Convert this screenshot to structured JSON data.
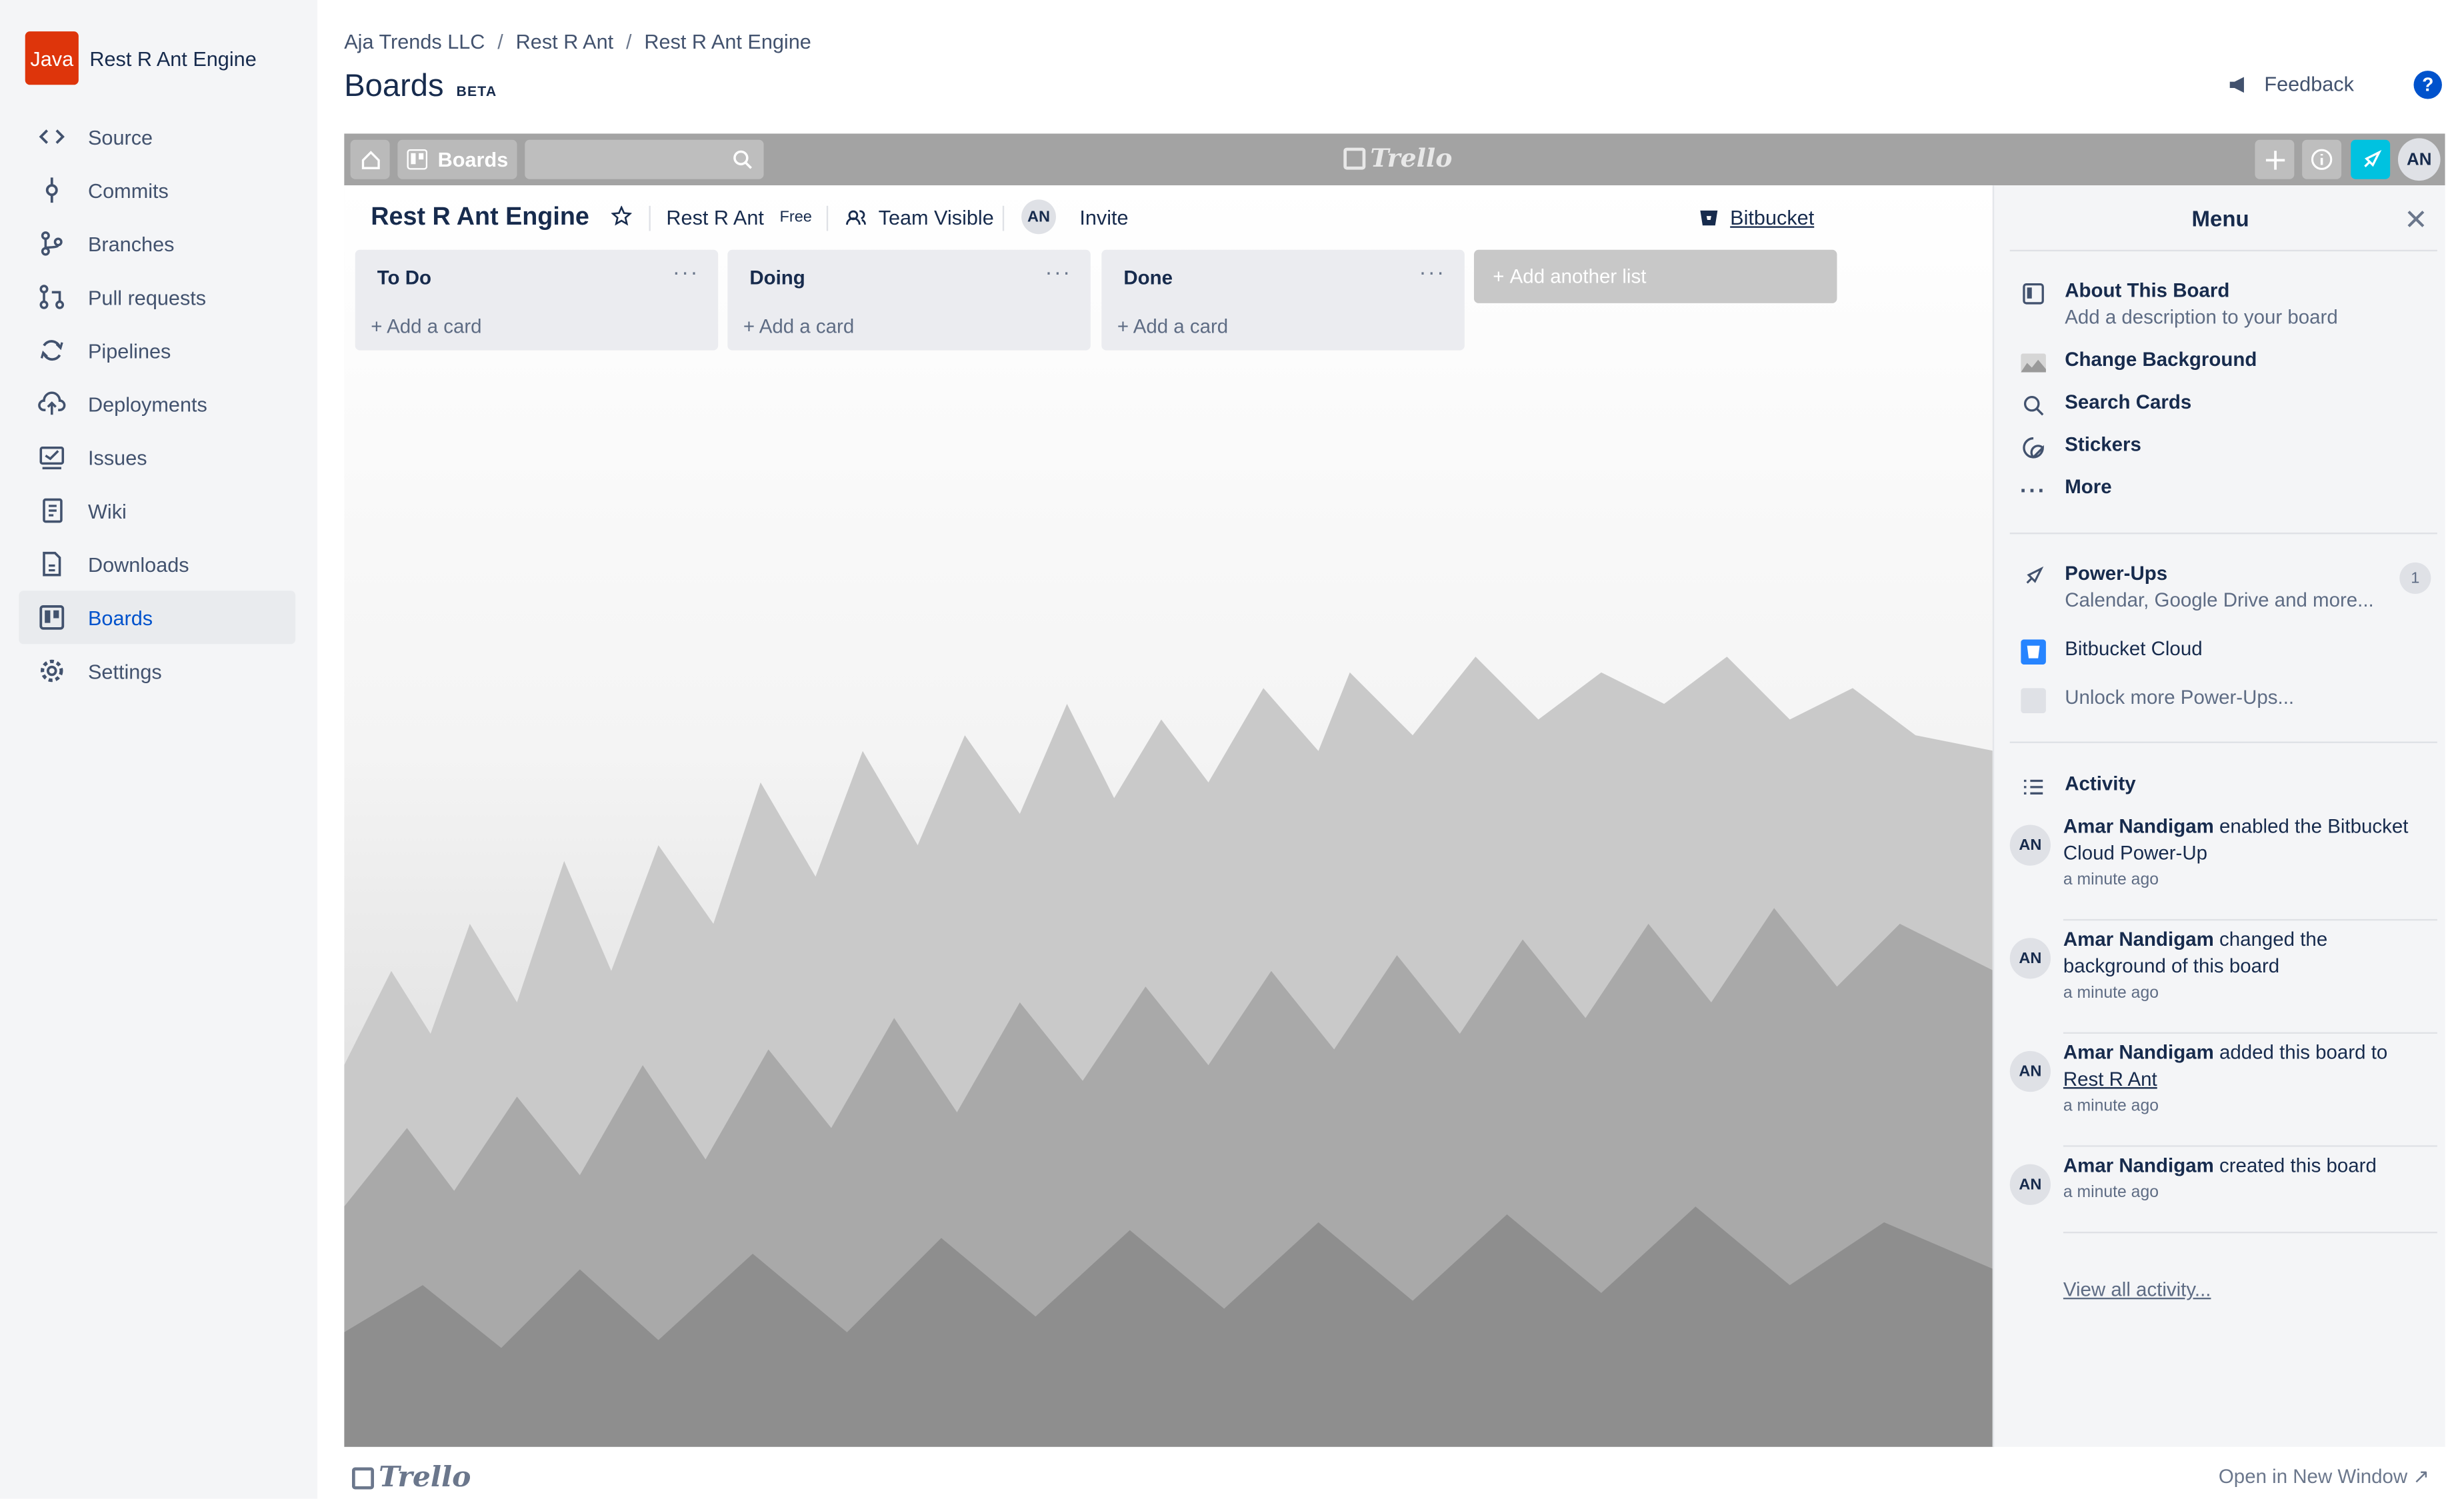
{
  "sidebar": {
    "repo_badge": "Java",
    "repo_name": "Rest R Ant Engine",
    "items": [
      {
        "label": "Source",
        "icon": "code-icon"
      },
      {
        "label": "Commits",
        "icon": "commit-icon"
      },
      {
        "label": "Branches",
        "icon": "branch-icon"
      },
      {
        "label": "Pull requests",
        "icon": "pull-request-icon"
      },
      {
        "label": "Pipelines",
        "icon": "pipelines-icon"
      },
      {
        "label": "Deployments",
        "icon": "cloud-upload-icon"
      },
      {
        "label": "Issues",
        "icon": "issues-icon"
      },
      {
        "label": "Wiki",
        "icon": "wiki-icon"
      },
      {
        "label": "Downloads",
        "icon": "downloads-icon"
      },
      {
        "label": "Boards",
        "icon": "boards-icon",
        "active": true
      },
      {
        "label": "Settings",
        "icon": "gear-icon"
      }
    ]
  },
  "header": {
    "breadcrumbs": [
      "Aja Trends LLC",
      "Rest R Ant",
      "Rest R Ant Engine"
    ],
    "title": "Boards",
    "badge": "BETA",
    "feedback": "Feedback",
    "help": "?"
  },
  "trello": {
    "topbar": {
      "boards_label": "Boards",
      "logo": "Trello",
      "avatar": "AN"
    },
    "board": {
      "name": "Rest R Ant Engine",
      "team": "Rest R Ant",
      "plan": "Free",
      "visibility": "Team Visible",
      "member_avatar": "AN",
      "invite": "Invite",
      "bitbucket": "Bitbucket"
    },
    "lists": [
      {
        "title": "To Do",
        "add_card": "Add a card"
      },
      {
        "title": "Doing",
        "add_card": "Add a card"
      },
      {
        "title": "Done",
        "add_card": "Add a card"
      }
    ],
    "add_list": "Add another list",
    "menu": {
      "title": "Menu",
      "about_title": "About This Board",
      "about_sub": "Add a description to your board",
      "change_background": "Change Background",
      "search_cards": "Search Cards",
      "stickers": "Stickers",
      "more": "More",
      "powerups_title": "Power-Ups",
      "powerups_sub": "Calendar, Google Drive and more...",
      "powerups_count": "1",
      "bitbucket_cloud": "Bitbucket Cloud",
      "unlock": "Unlock more Power-Ups...",
      "activity_title": "Activity",
      "activity": [
        {
          "avatar": "AN",
          "user": "Amar Nandigam",
          "text": " enabled the Bitbucket Cloud Power-Up",
          "link": "",
          "time": "a minute ago"
        },
        {
          "avatar": "AN",
          "user": "Amar Nandigam",
          "text": " changed the background of this board",
          "link": "",
          "time": "a minute ago"
        },
        {
          "avatar": "AN",
          "user": "Amar Nandigam",
          "text": " added this board to ",
          "link": "Rest R Ant",
          "time": "a minute ago"
        },
        {
          "avatar": "AN",
          "user": "Amar Nandigam",
          "text": " created this board",
          "link": "",
          "time": "a minute ago"
        }
      ],
      "view_all": "View all activity..."
    },
    "footer_logo": "Trello",
    "open_new": "Open in New Window ↗"
  },
  "colors": {
    "accent": "#0052CC",
    "repo_badge": "#DE350B",
    "topbar": "#A3A3A3",
    "powerups_active": "#00C2E0"
  }
}
